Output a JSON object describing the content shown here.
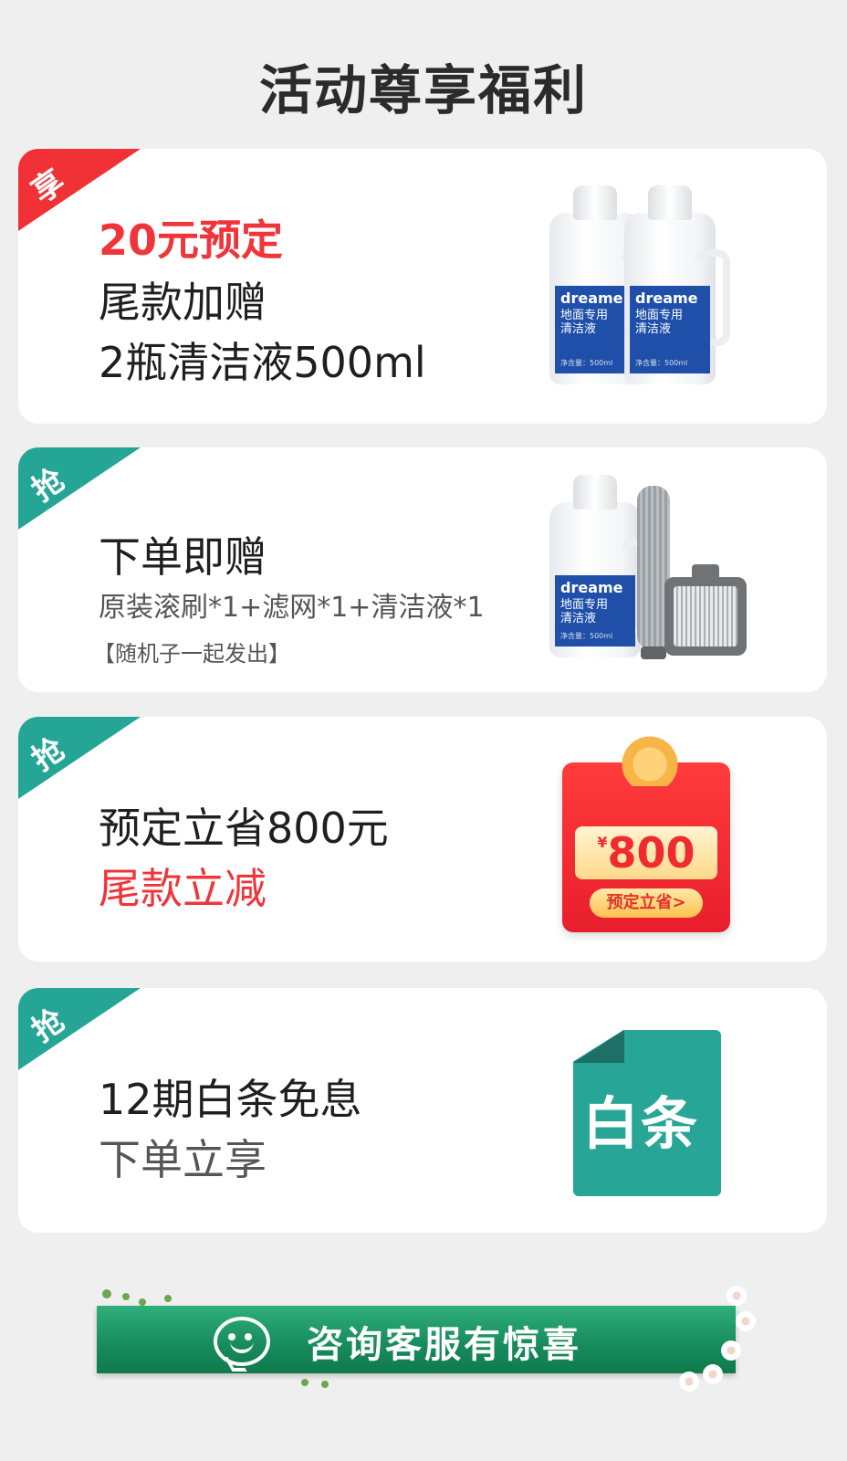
{
  "page": {
    "title": "活动尊享福利"
  },
  "cards": [
    {
      "corner": "享",
      "lines": [
        "20元预定",
        "尾款加赠",
        "2瓶清洁液500ml"
      ],
      "bottle": {
        "brand": "dreame",
        "name1": "地面专用",
        "name2": "清洁液",
        "volume": "净含量：500ml"
      }
    },
    {
      "corner": "抢",
      "title": "下单即赠",
      "detail": "原装滚刷*1+滤网*1+清洁液*1",
      "note": "【随机子一起发出】",
      "bottle": {
        "brand": "dreame",
        "name1": "地面专用",
        "name2": "清洁液",
        "volume": "净含量：500ml"
      }
    },
    {
      "corner": "抢",
      "lines": [
        "预定立省800元",
        "尾款立减"
      ],
      "coupon": {
        "currency": "¥",
        "amount": "800",
        "button": "预定立省>"
      }
    },
    {
      "corner": "抢",
      "lines": [
        "12期白条免息",
        "下单立享"
      ],
      "icon_text": "白条"
    }
  ],
  "service": {
    "label": "咨询客服有惊喜"
  },
  "colors": {
    "red": "#f03237",
    "teal": "#25a596",
    "green": "#178a5c"
  }
}
